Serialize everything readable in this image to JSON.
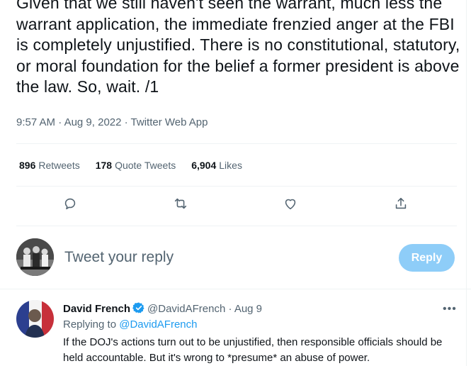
{
  "tweet": {
    "text": "Given that we still haven't seen the warrant, much less the warrant application, the immediate frenzied anger at the FBI is completely unjustified. There is no constitutional, statutory, or moral foundation for the belief a former president is above the law. So, wait. /1",
    "time": "9:57 AM",
    "date": "Aug 9, 2022",
    "source": "Twitter Web App",
    "separator": "·"
  },
  "stats": {
    "retweets_count": "896",
    "retweets_label": "Retweets",
    "quotes_count": "178",
    "quotes_label": "Quote Tweets",
    "likes_count": "6,904",
    "likes_label": "Likes"
  },
  "actions": {
    "reply_icon": "reply-icon",
    "retweet_icon": "retweet-icon",
    "like_icon": "heart-icon",
    "share_icon": "share-icon"
  },
  "compose": {
    "placeholder": "Tweet your reply",
    "button_label": "Reply",
    "button_color": "#8ecdf8"
  },
  "reply": {
    "name": "David French",
    "handle": "@DavidAFrench",
    "separator": "·",
    "date": "Aug 9",
    "replying_prefix": "Replying to",
    "replying_to": "@DavidAFrench",
    "text": "If the DOJ's actions turn out to be unjustified, then responsible officials should be held accountable. But it's wrong to *presume* an abuse of power.",
    "more": "•••"
  },
  "colors": {
    "accent": "#1d9bf0",
    "muted": "#536471",
    "text": "#0f1419",
    "divider": "#eff3f4"
  }
}
